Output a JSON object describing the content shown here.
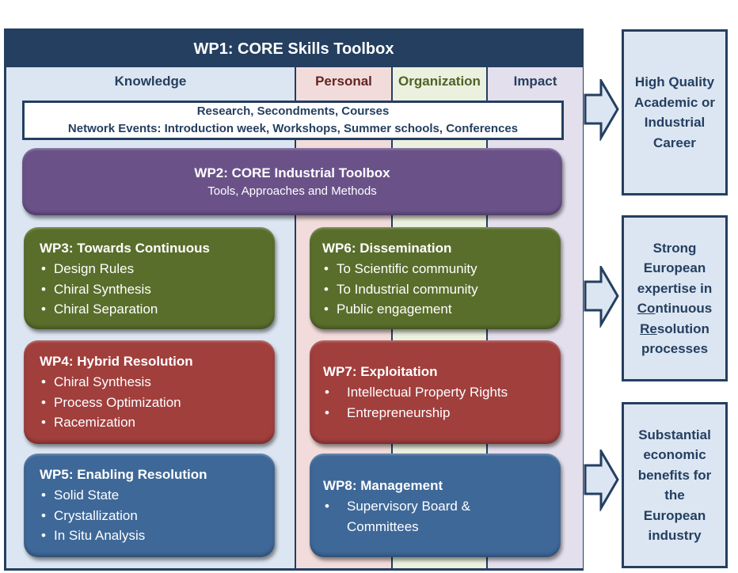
{
  "wp1": {
    "title": "WP1: CORE Skills Toolbox",
    "columns": [
      {
        "label": "Knowledge"
      },
      {
        "label": "Personal"
      },
      {
        "label": "Organization"
      },
      {
        "label": "Impact"
      }
    ]
  },
  "band": {
    "line1": "Research, Secondments, Courses",
    "line2": "Network Events: Introduction week, Workshops, Summer schools, Conferences"
  },
  "wp2": {
    "title": "WP2: CORE Industrial Toolbox",
    "subtitle": "Tools, Approaches and Methods"
  },
  "work_packages": {
    "wp3": {
      "title": "WP3: Towards Continuous",
      "items": [
        "Design Rules",
        "Chiral Synthesis",
        "Chiral Separation"
      ]
    },
    "wp4": {
      "title": "WP4: Hybrid Resolution",
      "items": [
        "Chiral Synthesis",
        "Process Optimization",
        "Racemization"
      ]
    },
    "wp5": {
      "title": "WP5: Enabling Resolution",
      "items": [
        "Solid State",
        "Crystallization",
        "In Situ Analysis"
      ]
    },
    "wp6": {
      "title": "WP6: Dissemination",
      "items": [
        "To Scientific community",
        "To Industrial community",
        "Public engagement"
      ]
    },
    "wp7": {
      "title": "WP7: Exploitation",
      "items": [
        "Intellectual Property Rights",
        "Entrepreneurship"
      ]
    },
    "wp8": {
      "title": "WP8: Management",
      "items": [
        "Supervisory Board &",
        "Committees"
      ]
    }
  },
  "bullet": "•",
  "outcomes": [
    {
      "lines": [
        "High Quality",
        "Academic or",
        "Industrial",
        "Career"
      ]
    },
    {
      "lines": [
        "Strong",
        "European",
        "expertise in"
      ],
      "underlined_1": "Co",
      "rest_1": "ntinuous",
      "underlined_2": "Re",
      "rest_2": "solution",
      "last": "processes"
    },
    {
      "lines": [
        "Substantial",
        "economic",
        "benefits for",
        "the",
        "European",
        "industry"
      ]
    }
  ],
  "colors": {
    "navy": "#243f60",
    "purple": "#6a5289",
    "green": "#5a6e2c",
    "red": "#a13f3d",
    "blue": "#3e6898",
    "knowledge_bg": "#dce6f2",
    "personal_bg": "#f2dcdb",
    "organization_bg": "#ebf1de",
    "impact_bg": "#e4dfec"
  }
}
